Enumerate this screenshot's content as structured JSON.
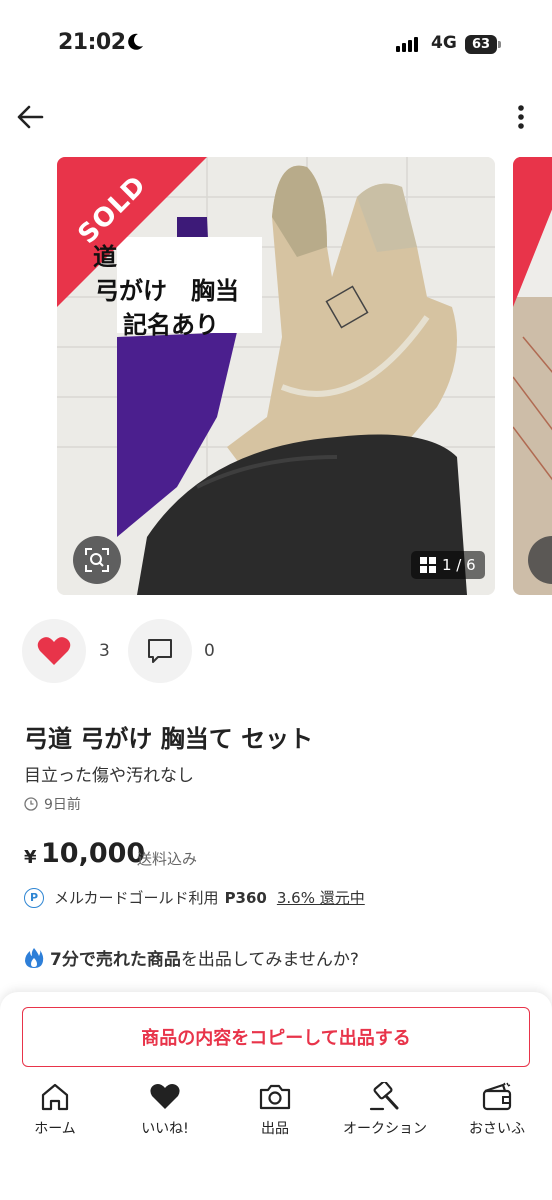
{
  "status_bar": {
    "time": "21:02",
    "network": "4G",
    "battery": "63"
  },
  "item": {
    "sold_label": "SOLD",
    "image_text_lines": [
      "道",
      "弓がけ　胸当",
      "記名あり"
    ],
    "image_counter": "1 / 6",
    "like_count": "3",
    "comment_count": "0",
    "title": "弓道 弓がけ 胸当て セット",
    "subtitle": "目立った傷や汚れなし",
    "posted": "9日前",
    "price_currency": "¥",
    "price": "10,000",
    "shipping": "送料込み"
  },
  "points": {
    "badge": "P",
    "label": "メルカードゴールド利用",
    "amount": "P360",
    "rate": "3.6% 還元中"
  },
  "promo": {
    "bold": "7分で売れた商品",
    "rest": "を出品してみませんか?"
  },
  "copy_button": "商品の内容をコピーして出品する",
  "nav": [
    {
      "label": "ホーム",
      "icon": "home-icon"
    },
    {
      "label": "いいね!",
      "icon": "heart-icon"
    },
    {
      "label": "出品",
      "icon": "camera-icon"
    },
    {
      "label": "オークション",
      "icon": "gavel-icon"
    },
    {
      "label": "おさいふ",
      "icon": "wallet-icon"
    }
  ],
  "colors": {
    "accent": "#e8344a",
    "like": "#e8344a",
    "points_blue": "#2f86d3",
    "promo_flame": "#2e7fd8"
  }
}
